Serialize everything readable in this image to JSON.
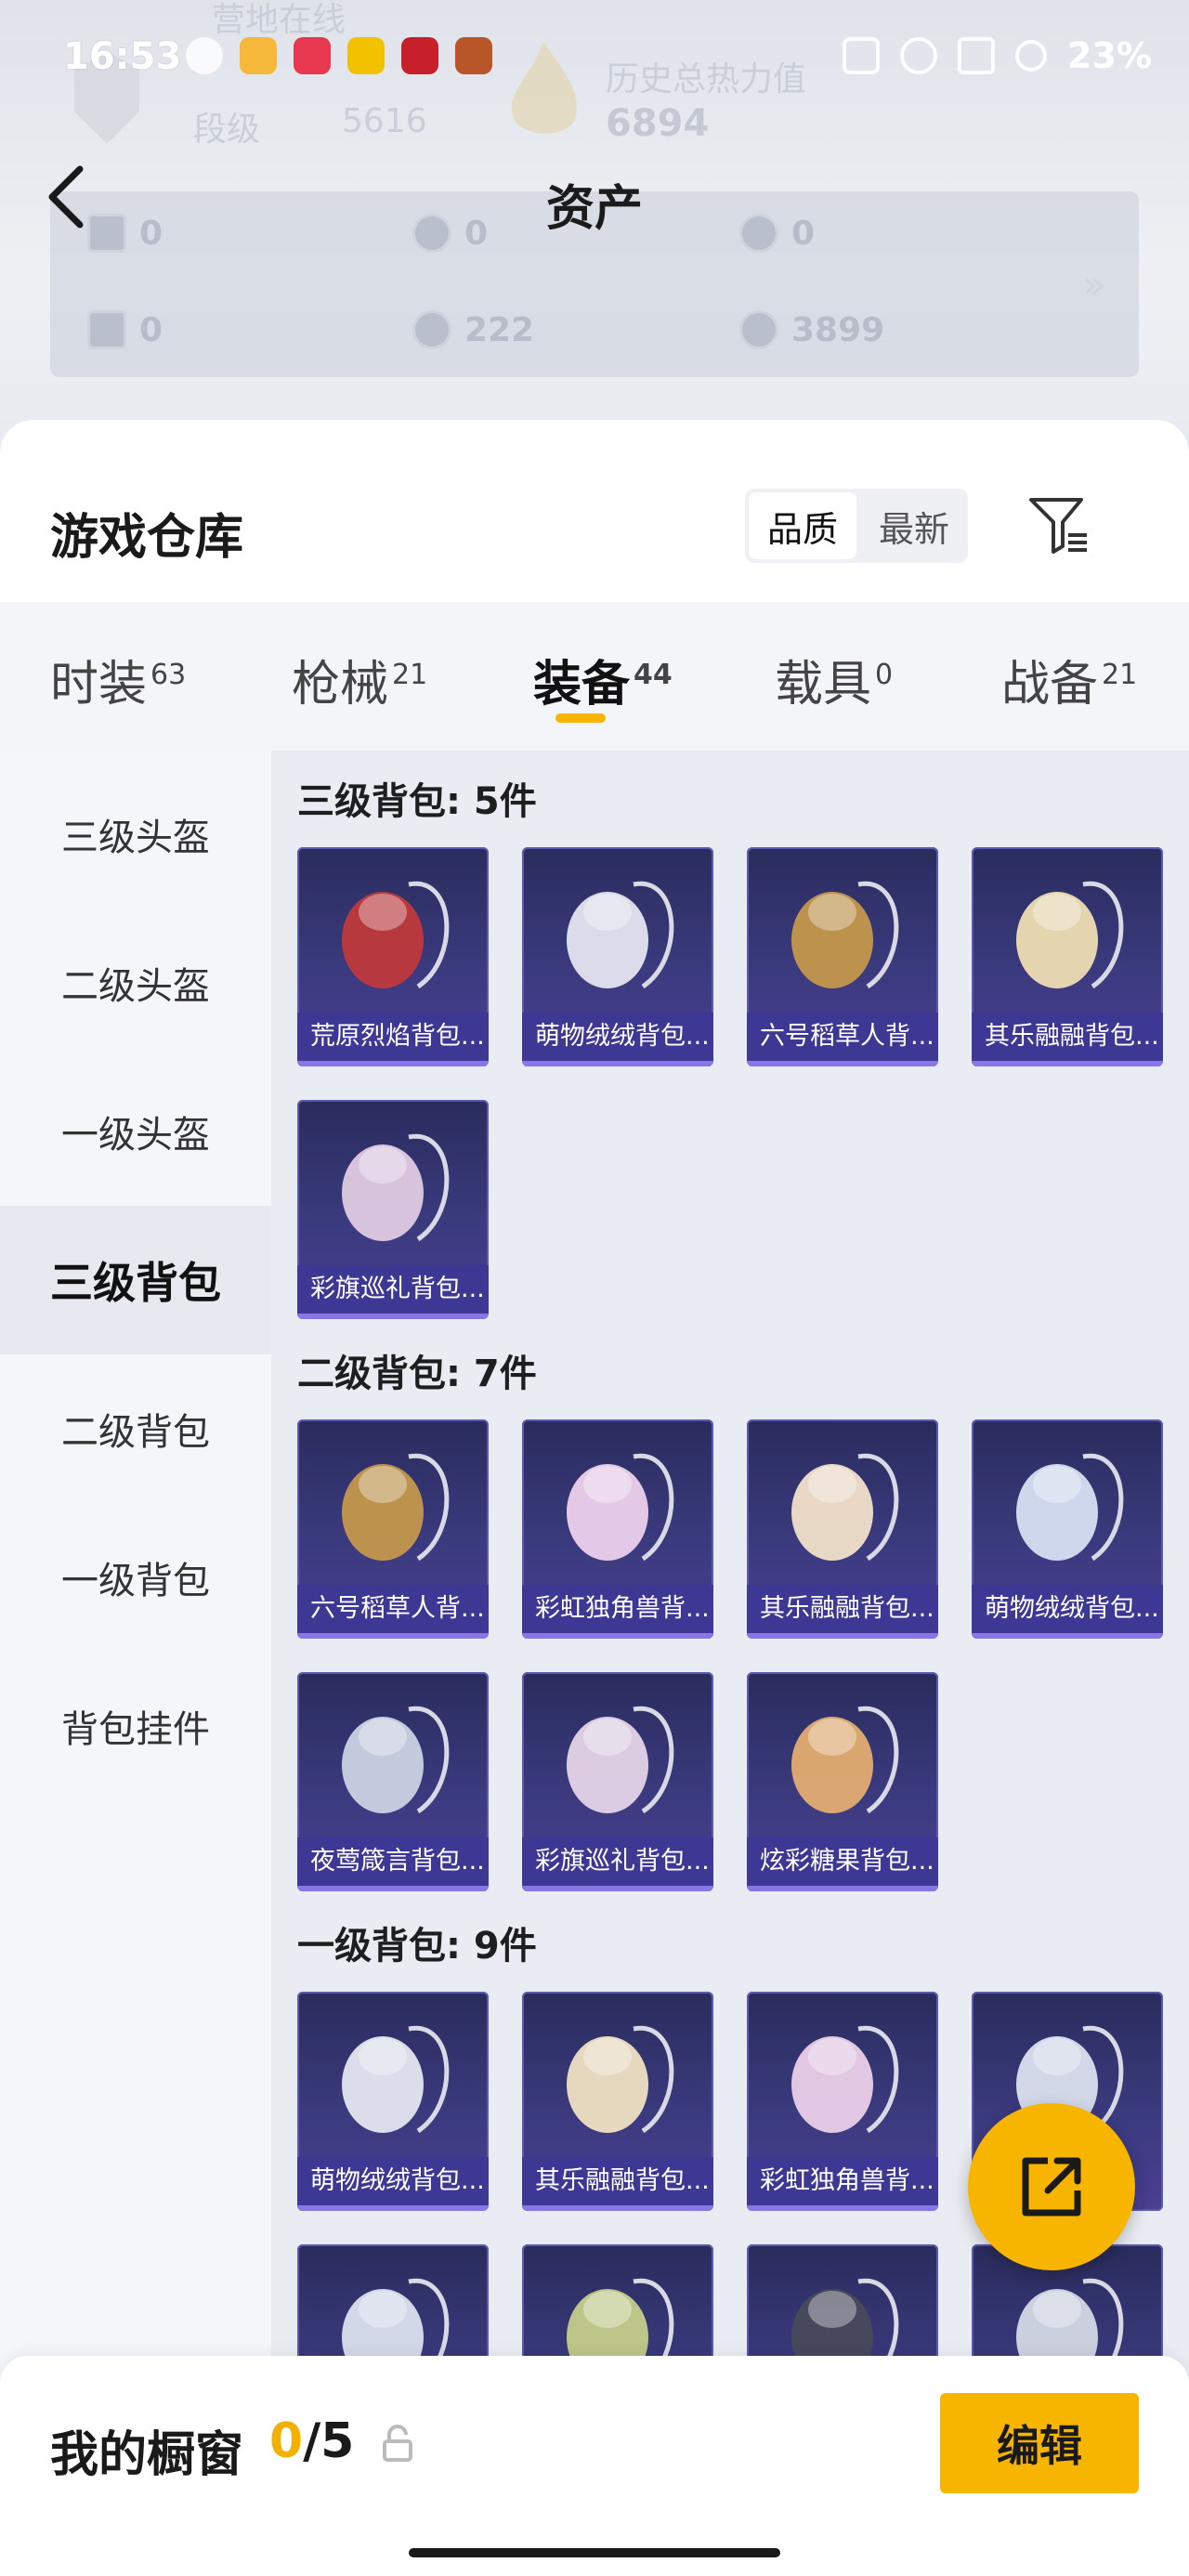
{
  "status_bar": {
    "time": "16:53",
    "battery": "23%"
  },
  "header": {
    "title": "资产",
    "ghost_rank_label": "段级",
    "ghost_points": "5616",
    "ghost_history_label": "历史总热力值",
    "ghost_stat": "6894",
    "ghost_online": "营地在线"
  },
  "assets": {
    "row1": [
      "0",
      "0",
      "0"
    ],
    "row2": [
      "0",
      "222",
      "3899"
    ],
    "more_icon": "chevron-double-right-icon"
  },
  "warehouse": {
    "title": "游戏仓库",
    "sort_options": [
      "品质",
      "最新"
    ],
    "sort_active": "品质"
  },
  "categories": [
    {
      "label": "时装",
      "count": "63"
    },
    {
      "label": "枪械",
      "count": "21"
    },
    {
      "label": "装备",
      "count": "44"
    },
    {
      "label": "载具",
      "count": "0"
    },
    {
      "label": "战备",
      "count": "21"
    }
  ],
  "sidebar": [
    "三级头盔",
    "二级头盔",
    "一级头盔",
    "三级背包",
    "二级背包",
    "一级背包",
    "背包挂件"
  ],
  "groups": [
    {
      "title": "三级背包: 5件",
      "items": [
        "荒原烈焰背包...",
        "萌物绒绒背包...",
        "六号稻草人背...",
        "其乐融融背包...",
        "彩旗巡礼背包..."
      ]
    },
    {
      "title": "二级背包: 7件",
      "items": [
        "六号稻草人背...",
        "彩虹独角兽背...",
        "其乐融融背包...",
        "萌物绒绒背包...",
        "夜莺箴言背包...",
        "彩旗巡礼背包...",
        "炫彩糖果背包..."
      ]
    },
    {
      "title": "一级背包: 9件",
      "items": [
        "萌物绒绒背包...",
        "其乐融融背包...",
        "彩虹独角兽背...",
        "",
        "",
        "",
        "",
        ""
      ]
    }
  ],
  "showcase": {
    "title": "我的橱窗",
    "current": "0",
    "total": "/5",
    "edit_label": "编辑"
  },
  "colors": {
    "accent": "#f7b500",
    "card_bg": "#3a3a7e",
    "card_label": "#3e3896"
  }
}
